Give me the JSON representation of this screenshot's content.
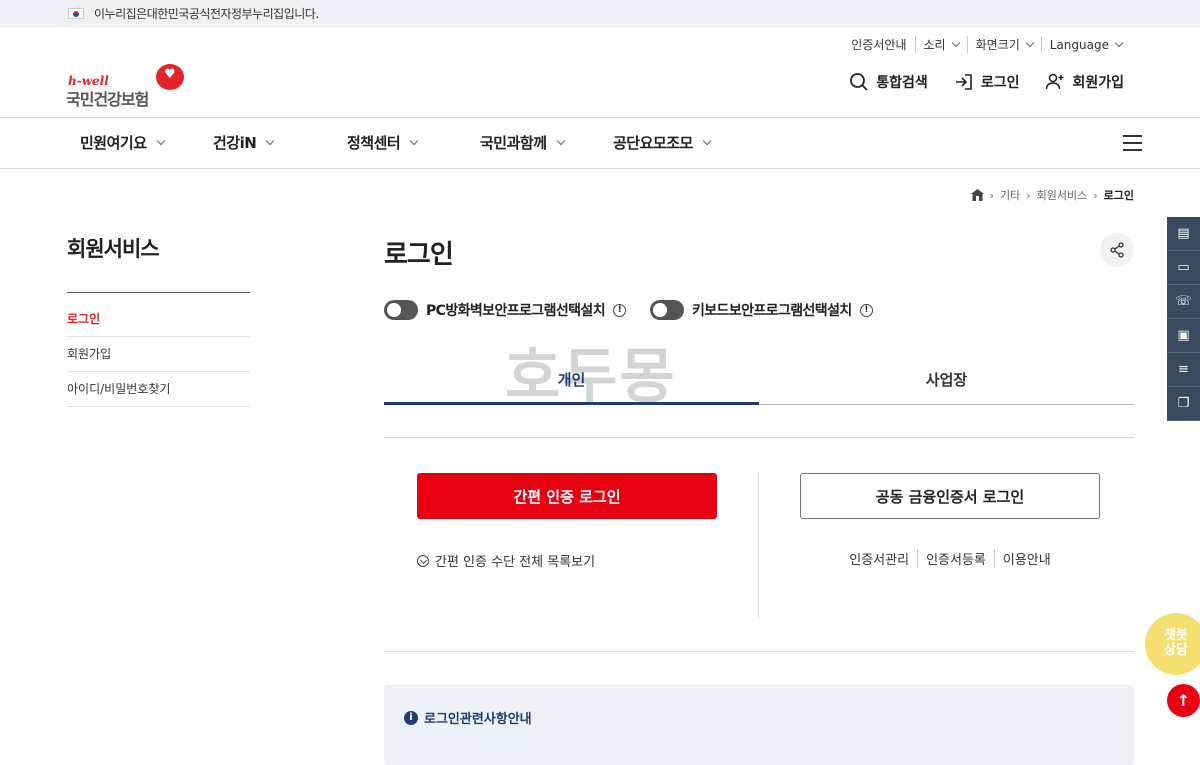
{
  "gov_bar": {
    "text": "이누리집은대한민국공식전자정부누리집입니다."
  },
  "util_menu": [
    "인증서안내",
    "소리",
    "화면크기",
    "Language"
  ],
  "logo": {
    "sub": "h-well",
    "name": "국민건강보험"
  },
  "header_actions": {
    "search": "통합검색",
    "login": "로그인",
    "join": "회원가입"
  },
  "gnb": [
    "민원여기요",
    "건강iN",
    "정책센터",
    "국민과함께",
    "공단요모조모"
  ],
  "breadcrumb": [
    "기타",
    "회원서비스",
    "로그인"
  ],
  "lnb": {
    "title": "회원서비스",
    "items": [
      "로그인",
      "회원가입",
      "아이디/비밀번호찾기"
    ]
  },
  "page": {
    "title": "로그인"
  },
  "toggles": [
    "PC방화벽보안프로그램선택설치",
    "키보드보안프로그램선택설치"
  ],
  "watermark": "호두몽",
  "tabs": [
    "개인",
    "사업장"
  ],
  "simple_login": {
    "button": "간편 인증 로그인",
    "list_link": "간편 인증 수단 전체 목록보기"
  },
  "cert_login": {
    "button": "공동 금융인증서 로그인",
    "links": [
      "인증서관리",
      "인증서등록",
      "이용안내"
    ]
  },
  "notice": {
    "title": "로그인관련사항안내"
  },
  "chatbot": {
    "line1": "챗봇",
    "line2": "상담"
  },
  "colors": {
    "accent_red": "#e60012",
    "navy": "#1d3e75"
  }
}
